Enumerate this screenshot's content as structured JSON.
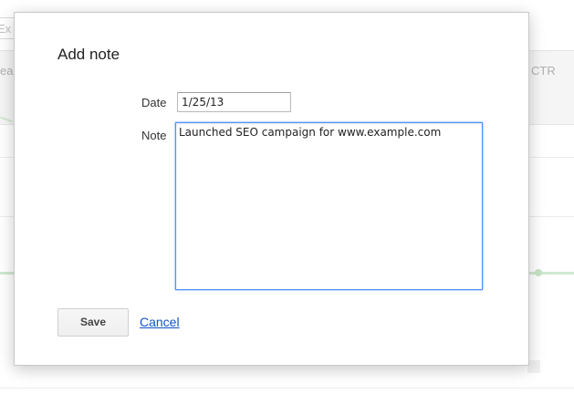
{
  "background": {
    "search_stub": "Ex",
    "column_left_stub": "ea",
    "column_right": "CTR"
  },
  "dialog": {
    "title": "Add note",
    "date_label": "Date",
    "date_value": "1/25/13",
    "note_label": "Note",
    "note_value": "Launched SEO campaign for www.example.com",
    "save_label": "Save",
    "cancel_label": "Cancel"
  },
  "colors": {
    "focus_border": "#4d90fe",
    "link": "#1155cc"
  }
}
